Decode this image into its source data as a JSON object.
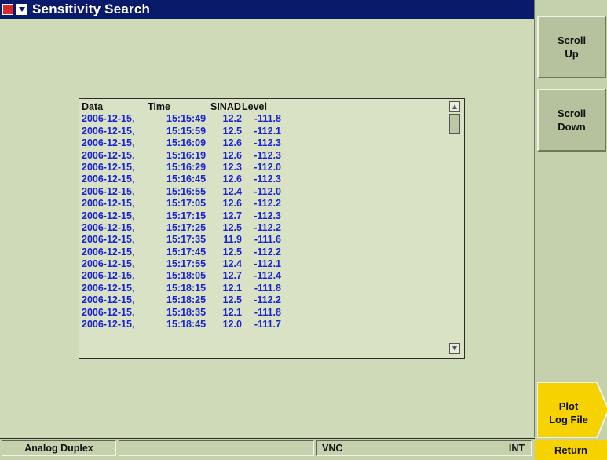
{
  "window": {
    "title": "Sensitivity Search"
  },
  "log_table": {
    "headers": {
      "date": "Data",
      "time": "Time",
      "sinad": "SINAD",
      "level": "Level"
    },
    "rows": [
      {
        "date": "2006-12-15,",
        "time": "15:15:49",
        "sinad": "12.2",
        "level": "-111.8"
      },
      {
        "date": "2006-12-15,",
        "time": "15:15:59",
        "sinad": "12.5",
        "level": "-112.1"
      },
      {
        "date": "2006-12-15,",
        "time": "15:16:09",
        "sinad": "12.6",
        "level": "-112.3"
      },
      {
        "date": "2006-12-15,",
        "time": "15:16:19",
        "sinad": "12.6",
        "level": "-112.3"
      },
      {
        "date": "2006-12-15,",
        "time": "15:16:29",
        "sinad": "12.3",
        "level": "-112.0"
      },
      {
        "date": "2006-12-15,",
        "time": "15:16:45",
        "sinad": "12.6",
        "level": "-112.3"
      },
      {
        "date": "2006-12-15,",
        "time": "15:16:55",
        "sinad": "12.4",
        "level": "-112.0"
      },
      {
        "date": "2006-12-15,",
        "time": "15:17:05",
        "sinad": "12.6",
        "level": "-112.2"
      },
      {
        "date": "2006-12-15,",
        "time": "15:17:15",
        "sinad": "12.7",
        "level": "-112.3"
      },
      {
        "date": "2006-12-15,",
        "time": "15:17:25",
        "sinad": "12.5",
        "level": "-112.2"
      },
      {
        "date": "2006-12-15,",
        "time": "15:17:35",
        "sinad": "11.9",
        "level": "-111.6"
      },
      {
        "date": "2006-12-15,",
        "time": "15:17:45",
        "sinad": "12.5",
        "level": "-112.2"
      },
      {
        "date": "2006-12-15,",
        "time": "15:17:55",
        "sinad": "12.4",
        "level": "-112.1"
      },
      {
        "date": "2006-12-15,",
        "time": "15:18:05",
        "sinad": "12.7",
        "level": "-112.4"
      },
      {
        "date": "2006-12-15,",
        "time": "15:18:15",
        "sinad": "12.1",
        "level": "-111.8"
      },
      {
        "date": "2006-12-15,",
        "time": "15:18:25",
        "sinad": "12.5",
        "level": "-112.2"
      },
      {
        "date": "2006-12-15,",
        "time": "15:18:35",
        "sinad": "12.1",
        "level": "-111.8"
      },
      {
        "date": "2006-12-15,",
        "time": "15:18:45",
        "sinad": "12.0",
        "level": "-111.7"
      }
    ]
  },
  "softkeys": {
    "scroll_up": "Scroll\nUp",
    "scroll_down": "Scroll\nDown",
    "plot_log_file": "Plot\nLog File",
    "return": "Return"
  },
  "statusbar": {
    "mode": "Analog Duplex",
    "middle": "",
    "connection": "VNC",
    "reference": "INT"
  },
  "colors": {
    "title_bar": "#0a1a6b",
    "data_text": "#1a22d6",
    "accent_key": "#f5d200"
  }
}
